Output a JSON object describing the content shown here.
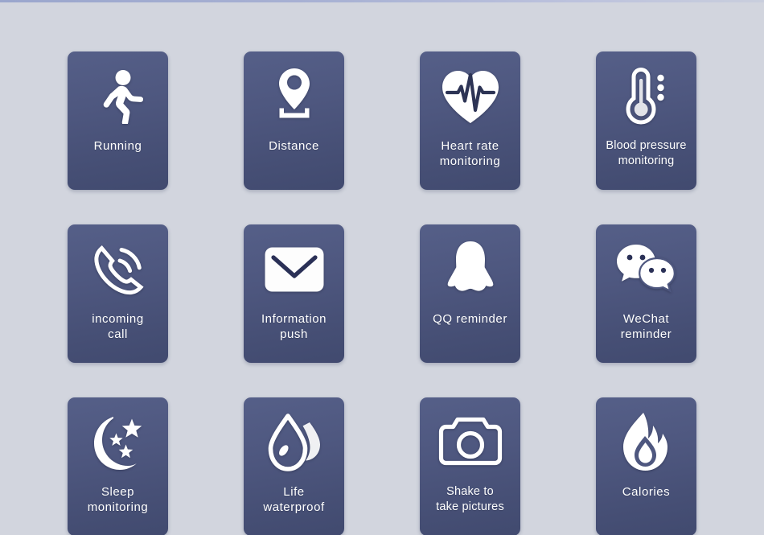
{
  "page": {
    "title": "Smart Watch Feature Grid",
    "background_color": "#d2d5de",
    "card_color": "#4e577f",
    "icon_color": "#ffffff",
    "top_strip_color": "#a9b2d4",
    "columns": 4,
    "rows": 3
  },
  "features": [
    {
      "id": "running",
      "icon": "running-icon",
      "label": "Running"
    },
    {
      "id": "distance",
      "icon": "location-pin-icon",
      "label": "Distance"
    },
    {
      "id": "heart-rate",
      "icon": "heart-ecg-icon",
      "label": "Heart rate\nmonitoring"
    },
    {
      "id": "blood-pressure",
      "icon": "thermometer-icon",
      "label": "Blood pressure\nmonitoring"
    },
    {
      "id": "incoming-call",
      "icon": "phone-ringing-icon",
      "label": "incoming\ncall"
    },
    {
      "id": "information-push",
      "icon": "envelope-icon",
      "label": "Information\npush"
    },
    {
      "id": "qq-reminder",
      "icon": "qq-penguin-icon",
      "label": "QQ reminder"
    },
    {
      "id": "wechat-reminder",
      "icon": "wechat-bubbles-icon",
      "label": "WeChat\nreminder"
    },
    {
      "id": "sleep-monitoring",
      "icon": "moon-stars-icon",
      "label": "Sleep\nmonitoring"
    },
    {
      "id": "life-waterproof",
      "icon": "water-droplet-icon",
      "label": "Life\nwaterproof"
    },
    {
      "id": "shake-photo",
      "icon": "camera-icon",
      "label": "Shake to\ntake pictures"
    },
    {
      "id": "calories",
      "icon": "flame-icon",
      "label": "Calories"
    }
  ]
}
